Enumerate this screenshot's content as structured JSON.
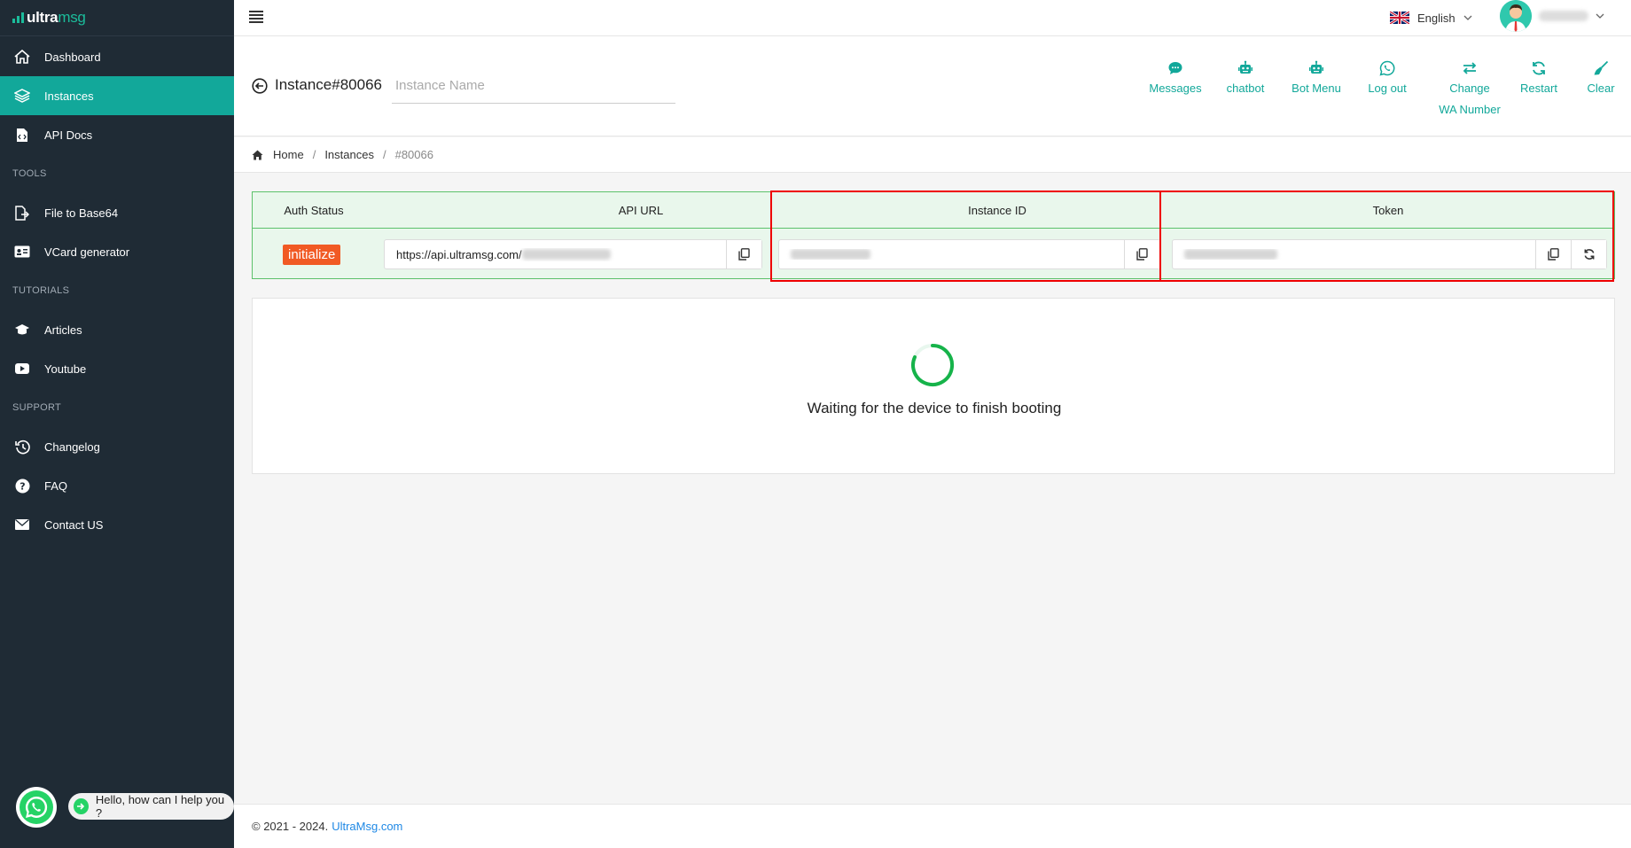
{
  "brand": {
    "logo_prefix": "ultra",
    "logo_suffix": "msg",
    "accent_color": "#12a89a"
  },
  "sidebar": {
    "items": [
      {
        "label": "Dashboard",
        "icon": "home-icon"
      },
      {
        "label": "Instances",
        "icon": "layers-icon",
        "active": true
      },
      {
        "label": "API Docs",
        "icon": "file-code-icon"
      }
    ],
    "tools_title": "TOOLS",
    "tools": [
      {
        "label": "File to Base64",
        "icon": "file-export-icon"
      },
      {
        "label": "VCard generator",
        "icon": "id-card-icon"
      }
    ],
    "tutorials_title": "TUTORIALS",
    "tutorials": [
      {
        "label": "Articles",
        "icon": "graduation-cap-icon"
      },
      {
        "label": "Youtube",
        "icon": "youtube-icon"
      }
    ],
    "support_title": "SUPPORT",
    "support": [
      {
        "label": "Changelog",
        "icon": "history-icon"
      },
      {
        "label": "FAQ",
        "icon": "question-icon"
      },
      {
        "label": "Contact US",
        "icon": "envelope-icon"
      }
    ]
  },
  "topbar": {
    "language": "English"
  },
  "header": {
    "instance_title": "Instance#80066",
    "instance_name_placeholder": "Instance Name",
    "actions": [
      {
        "label": "Messages",
        "icon": "comment-icon"
      },
      {
        "label": "chatbot",
        "icon": "robot-icon"
      },
      {
        "label": "Bot Menu",
        "icon": "robot-icon"
      },
      {
        "label": "Log out",
        "icon": "whatsapp-icon"
      },
      {
        "label": "Change",
        "label2": "WA Number",
        "icon": "exchange-icon"
      },
      {
        "label": "Restart",
        "icon": "refresh-icon"
      },
      {
        "label": "Clear",
        "icon": "broom-icon"
      }
    ]
  },
  "breadcrumb": {
    "home": "Home",
    "instances": "Instances",
    "current": "#80066"
  },
  "info": {
    "headers": {
      "auth_status": "Auth Status",
      "api_url": "API URL",
      "instance_id": "Instance ID",
      "token": "Token"
    },
    "auth_status_value": "initialize",
    "api_url_value": "https://api.ultramsg.com/"
  },
  "status": {
    "message": "Waiting for the device to finish booting"
  },
  "footer": {
    "copyright": "© 2021 - 2024.",
    "link": "UltraMsg.com"
  },
  "chat_widget": {
    "text": "Hello, how can I help you ?"
  }
}
